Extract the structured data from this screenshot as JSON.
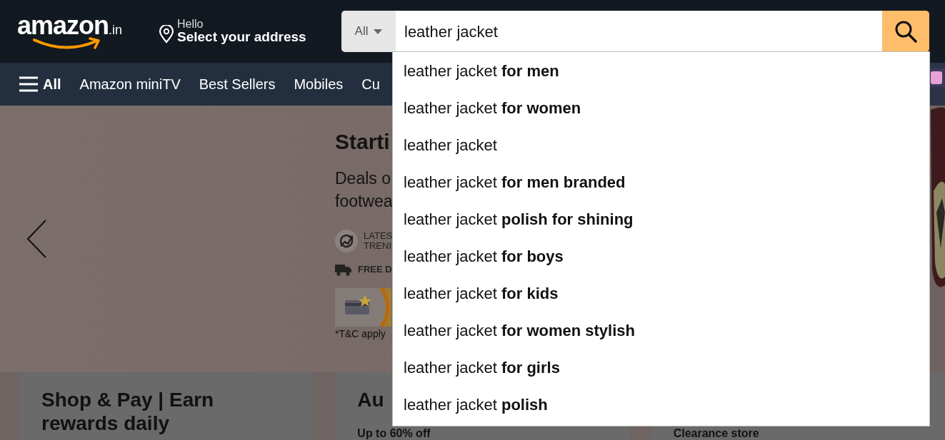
{
  "header": {
    "logo": {
      "text": "amazon",
      "suffix": ".in"
    },
    "address": {
      "greeting": "Hello",
      "label": "Select your address"
    },
    "search": {
      "category": "All",
      "value": "leather jacket"
    }
  },
  "nav": {
    "items": [
      {
        "label": "All",
        "kind": "menu"
      },
      {
        "label": "Amazon miniTV",
        "kind": "link"
      },
      {
        "label": "Best Sellers",
        "kind": "link"
      },
      {
        "label": "Mobiles",
        "kind": "link"
      },
      {
        "label": "Cu",
        "kind": "link"
      }
    ]
  },
  "suggestions": [
    {
      "text": "leather jacket **for men**"
    },
    {
      "text": "leather jacket **for women**"
    },
    {
      "text": "leather jacket"
    },
    {
      "text": "leather jacket **for men branded**"
    },
    {
      "text": "leather jacket **polish for shining**"
    },
    {
      "text": "leather jacket **for boys**"
    },
    {
      "text": "leather jacket **for kids**"
    },
    {
      "text": "leather jacket **for women stylish**"
    },
    {
      "text": "leather jacket **for girls**"
    },
    {
      "text": "leather jacket **polish**"
    }
  ],
  "hero": {
    "heading": "Starti",
    "body": [
      "Deals o",
      "footwea"
    ],
    "features": [
      {
        "kind": "trend",
        "lines": [
          "LATES",
          "TRENI"
        ]
      },
      {
        "kind": "truck",
        "lines": [
          "FREE D"
        ]
      }
    ],
    "terms": "*T&C apply"
  },
  "cards": [
    {
      "lines": [
        "Shop & Pay | Earn",
        "rewards daily"
      ]
    },
    {
      "lines": [
        "Au",
        "Up to 60% off"
      ]
    },
    {
      "lines": [
        "Clearance store"
      ]
    }
  ]
}
